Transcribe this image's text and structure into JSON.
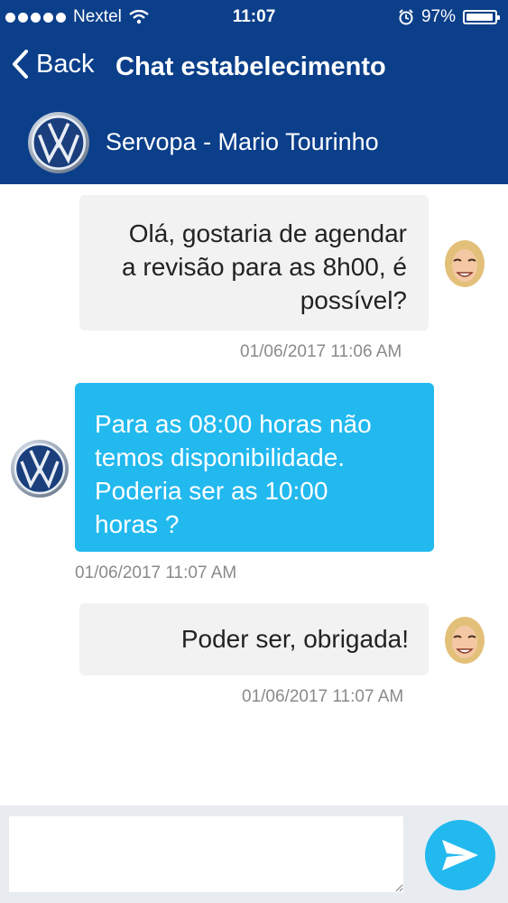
{
  "status_bar": {
    "carrier": "Nextel",
    "time": "11:07",
    "battery": "97%",
    "battery_level": 0.97,
    "signal_dots": 5
  },
  "nav": {
    "back_label": "Back",
    "title": "Chat estabelecimento"
  },
  "contact": {
    "name": "Servopa - Mario Tourinho",
    "logo_icon": "volkswagen-logo"
  },
  "messages": [
    {
      "direction": "outgoing",
      "lines": [
        "Olá, gostaria de agendar",
        "a revisão para as 8h00, é",
        "possível?"
      ],
      "timestamp": "01/06/2017 11:06 AM"
    },
    {
      "direction": "incoming",
      "lines": [
        "Para as 08:00 horas não",
        "temos disponibilidade.",
        "Poderia ser as 10:00",
        "horas ?"
      ],
      "timestamp": "01/06/2017 11:07 AM"
    },
    {
      "direction": "outgoing",
      "lines": [
        "Poder ser, obrigada!"
      ],
      "timestamp": "01/06/2017 11:07 AM"
    }
  ],
  "composer": {
    "value": "",
    "send_icon": "send-icon"
  },
  "colors": {
    "header": "#0b3f8a",
    "incoming_bubble": "#22b9ef",
    "outgoing_bubble": "#f2f2f2",
    "timestamp": "#8a8a8a"
  }
}
